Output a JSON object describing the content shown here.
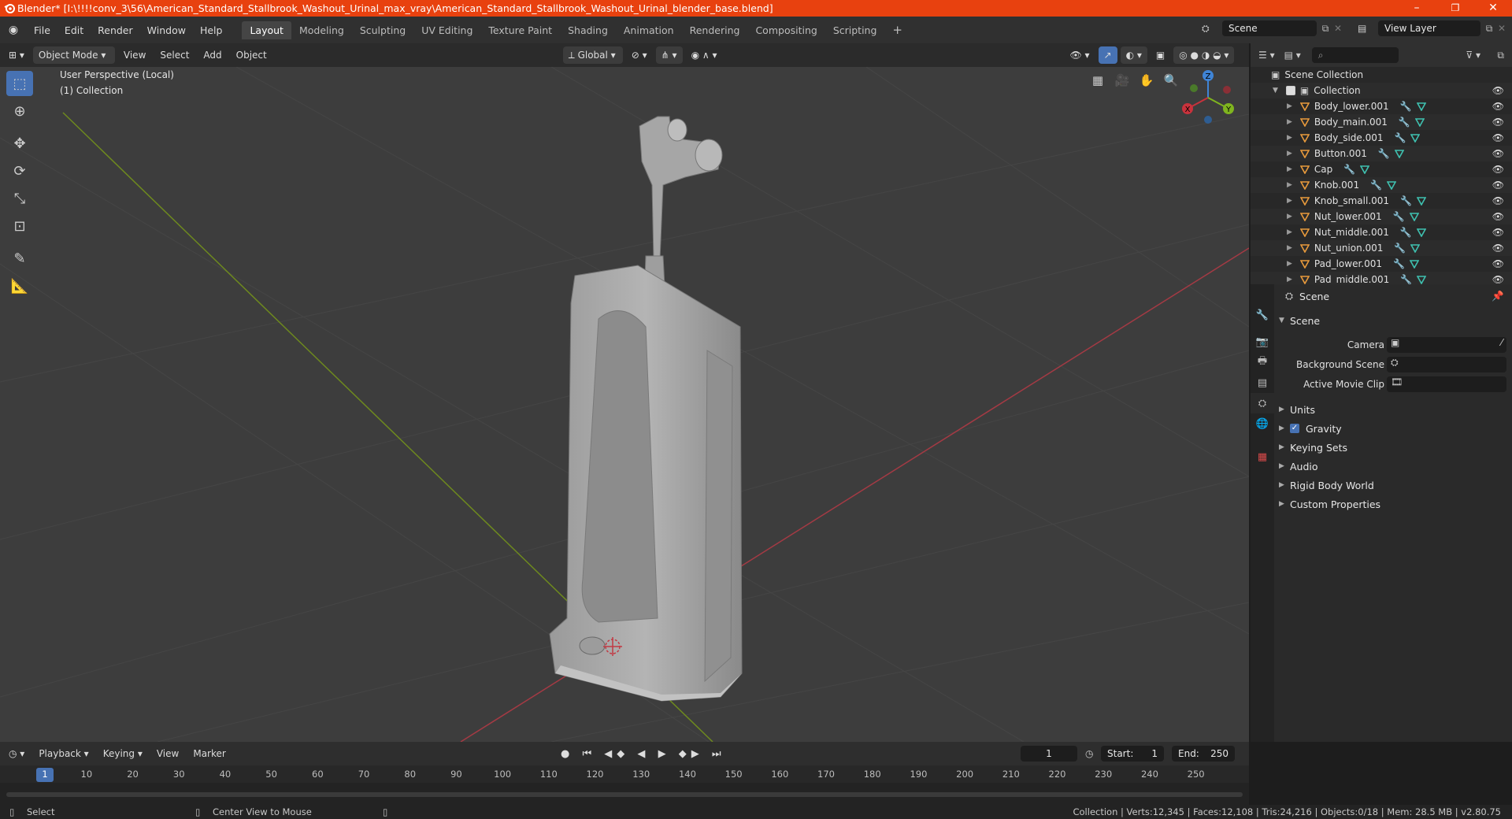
{
  "window": {
    "title": "Blender* [I:\\!!!!conv_3\\56\\American_Standard_Stallbrook_Washout_Urinal_max_vray\\American_Standard_Stallbrook_Washout_Urinal_blender_base.blend]",
    "controls": [
      "–",
      "❐",
      "✕"
    ]
  },
  "menu": [
    "File",
    "Edit",
    "Render",
    "Window",
    "Help"
  ],
  "workspaces": [
    "Layout",
    "Modeling",
    "Sculpting",
    "UV Editing",
    "Texture Paint",
    "Shading",
    "Animation",
    "Rendering",
    "Compositing",
    "Scripting"
  ],
  "active_workspace": "Layout",
  "scene_field": "Scene",
  "view_layer_field": "View Layer",
  "viewport_header": {
    "mode": "Object Mode",
    "menus": [
      "View",
      "Select",
      "Add",
      "Object"
    ],
    "transform": "Global"
  },
  "viewport": {
    "info_line1": "User Perspective (Local)",
    "info_line2": "(1) Collection",
    "gizmo_axes": [
      "Z",
      "X",
      "Y"
    ]
  },
  "outliner": {
    "root": "Scene Collection",
    "collection": "Collection",
    "items": [
      "Body_lower.001",
      "Body_main.001",
      "Body_side.001",
      "Button.001",
      "Cap",
      "Knob.001",
      "Knob_small.001",
      "Nut_lower.001",
      "Nut_middle.001",
      "Nut_union.001",
      "Pad_lower.001",
      "Pad_middle.001"
    ]
  },
  "properties": {
    "header": "Scene",
    "panel": "Scene",
    "fields": [
      "Camera",
      "Background Scene",
      "Active Movie Clip"
    ],
    "sections": [
      "Units",
      "Gravity",
      "Keying Sets",
      "Audio",
      "Rigid Body World",
      "Custom Properties"
    ],
    "gravity_checked": true
  },
  "timeline": {
    "menus": [
      "Playback",
      "Keying",
      "View",
      "Marker"
    ],
    "current_frame": "1",
    "start_label": "Start:",
    "start": "1",
    "end_label": "End:",
    "end": "250",
    "ticks": [
      "1",
      "10",
      "20",
      "30",
      "40",
      "50",
      "60",
      "70",
      "80",
      "90",
      "100",
      "110",
      "120",
      "130",
      "140",
      "150",
      "160",
      "170",
      "180",
      "190",
      "200",
      "210",
      "220",
      "230",
      "240",
      "250"
    ]
  },
  "statusbar": {
    "left": "Select",
    "middle": "Center View to Mouse",
    "right": "Collection | Verts:12,345 | Faces:12,108 | Tris:24,216 | Objects:0/18 | Mem: 28.5 MB | v2.80.75"
  },
  "colors": {
    "title_bar": "#e8410f",
    "accent": "#4772b3",
    "axis_x": "#c8323c",
    "axis_y": "#7fb41f",
    "axis_z": "#3f84d6",
    "mesh_icon": "#e89a3c",
    "data_icon": "#3fc1b0"
  }
}
